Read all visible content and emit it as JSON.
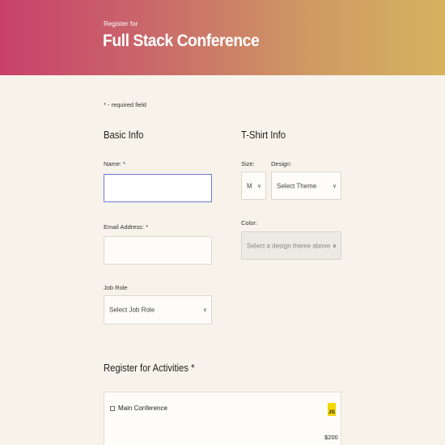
{
  "header": {
    "subtitle": "Register for",
    "title": "Full Stack Conference"
  },
  "required_note": "* - required field",
  "basic_info": {
    "title": "Basic Info",
    "name_label": "Name: *",
    "name_value": "",
    "email_label": "Email Address: *",
    "email_value": "",
    "job_role_label": "Job Role",
    "job_role_selected": "Select Job Role"
  },
  "tshirt_info": {
    "title": "T-Shirt Info",
    "size_label": "Size:",
    "size_selected": "M",
    "design_label": "Design:",
    "design_selected": "Select Theme",
    "color_label": "Color:",
    "color_selected": "Select a design theme above"
  },
  "activities": {
    "title": "Register for Activities *",
    "items": [
      {
        "label": "Main Conference",
        "badge": "JS",
        "price": "$200",
        "checked": false
      }
    ]
  },
  "colors": {
    "header_gradient_start": "#c9406b",
    "header_gradient_end": "#d6b25e",
    "page_bg": "#f7f3eb",
    "focus_border": "#6b7be0",
    "js_badge": "#f2d600"
  }
}
